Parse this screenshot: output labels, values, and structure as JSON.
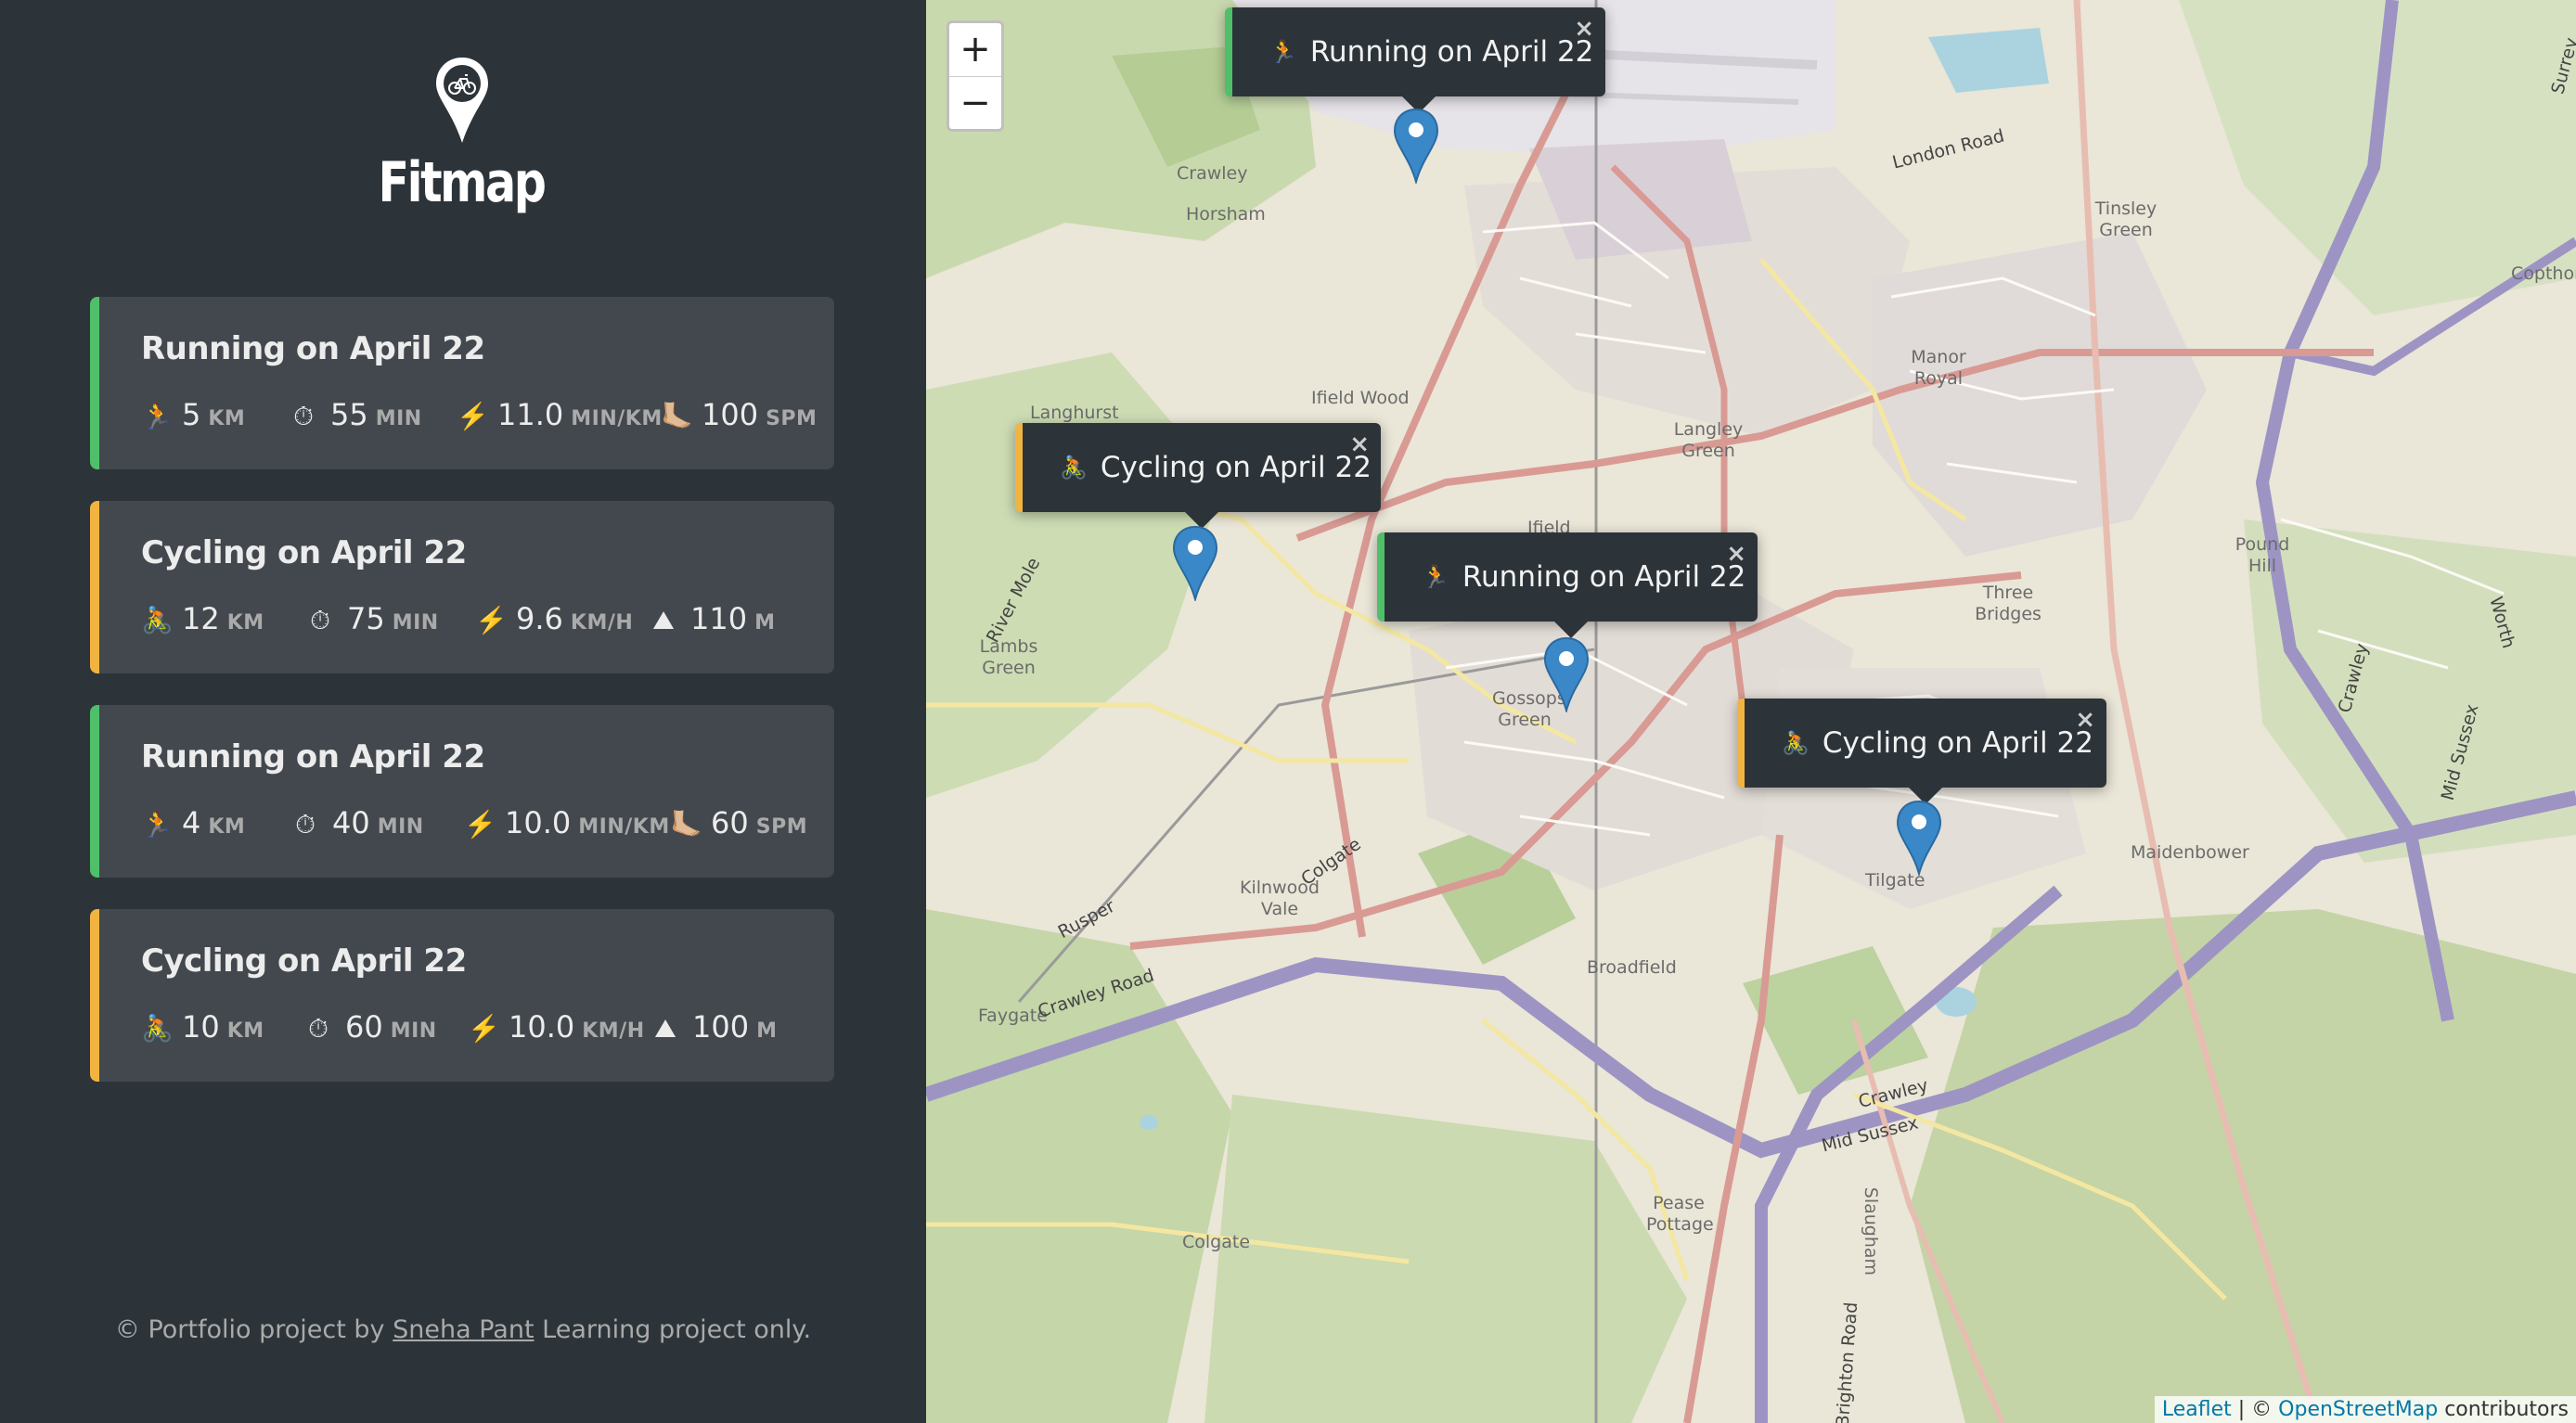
{
  "app": {
    "name": "Fitmap"
  },
  "workouts": [
    {
      "type": "running",
      "title": "Running on April 22",
      "stats": [
        {
          "icon": "🏃",
          "value": "5",
          "unit": "KM"
        },
        {
          "icon": "⏱",
          "value": "55",
          "unit": "MIN"
        },
        {
          "icon": "⚡️",
          "value": "11.0",
          "unit": "MIN/KM"
        },
        {
          "icon": "🦶🏼",
          "value": "100",
          "unit": "SPM"
        }
      ]
    },
    {
      "type": "cycling",
      "title": "Cycling on April 22",
      "stats": [
        {
          "icon": "🚴",
          "value": "12",
          "unit": "KM"
        },
        {
          "icon": "⏱",
          "value": "75",
          "unit": "MIN"
        },
        {
          "icon": "⚡️",
          "value": "9.6",
          "unit": "KM/H"
        },
        {
          "icon": "⛰",
          "value": "110",
          "unit": "M"
        }
      ]
    },
    {
      "type": "running",
      "title": "Running on April 22",
      "stats": [
        {
          "icon": "🏃",
          "value": "4",
          "unit": "KM"
        },
        {
          "icon": "⏱",
          "value": "40",
          "unit": "MIN"
        },
        {
          "icon": "⚡️",
          "value": "10.0",
          "unit": "MIN/KM"
        },
        {
          "icon": "🦶🏼",
          "value": "60",
          "unit": "SPM"
        }
      ]
    },
    {
      "type": "cycling",
      "title": "Cycling on April 22",
      "stats": [
        {
          "icon": "🚴",
          "value": "10",
          "unit": "KM"
        },
        {
          "icon": "⏱",
          "value": "60",
          "unit": "MIN"
        },
        {
          "icon": "⚡️",
          "value": "10.0",
          "unit": "KM/H"
        },
        {
          "icon": "⛰",
          "value": "100",
          "unit": "M"
        }
      ]
    }
  ],
  "footer": {
    "prefix": "© Portfolio project by",
    "author": "Sneha Pant",
    "suffix": "Learning project only."
  },
  "map": {
    "zoom_in": "+",
    "zoom_out": "−",
    "popups": [
      {
        "type": "running",
        "icon": "🏃",
        "label": "Running on April 22"
      },
      {
        "type": "cycling",
        "icon": "🚴",
        "label": "Cycling on April 22"
      },
      {
        "type": "running",
        "icon": "🏃",
        "label": "Running on April 22"
      },
      {
        "type": "cycling",
        "icon": "🚴",
        "label": "Cycling on April 22"
      }
    ],
    "close_symbol": "×",
    "attribution": {
      "leaflet": "Leaflet",
      "sep": "| ©",
      "osm": "OpenStreetMap",
      "suffix": "contributors"
    },
    "place_labels": [
      "Crawley",
      "Horsham",
      "Ifield Wood",
      "Langhurst",
      "Langley Green",
      "Manor Royal",
      "Tinsley Green",
      "Copthorne",
      "Ifield",
      "Three Bridges",
      "Pound Hill",
      "Lambs Green",
      "Gossops Green",
      "Tilgate",
      "Maidenbower",
      "Kilnwood Vale",
      "Faygate",
      "Broadfield",
      "Pease Pottage",
      "Colgate",
      "Slaugham",
      "Colgate",
      "Rusper",
      "Crawley Road",
      "London Road",
      "Crawley",
      "Mid Sussex",
      "River Mole",
      "Surrey",
      "Mid Sussex",
      "Crawley",
      "Worth",
      "Brighton Road"
    ]
  },
  "colors": {
    "running": "#4fbf6a",
    "cycling": "#f2b441",
    "sidebar": "#2d3439",
    "card": "#42484d",
    "marker": "#3a88c8"
  }
}
